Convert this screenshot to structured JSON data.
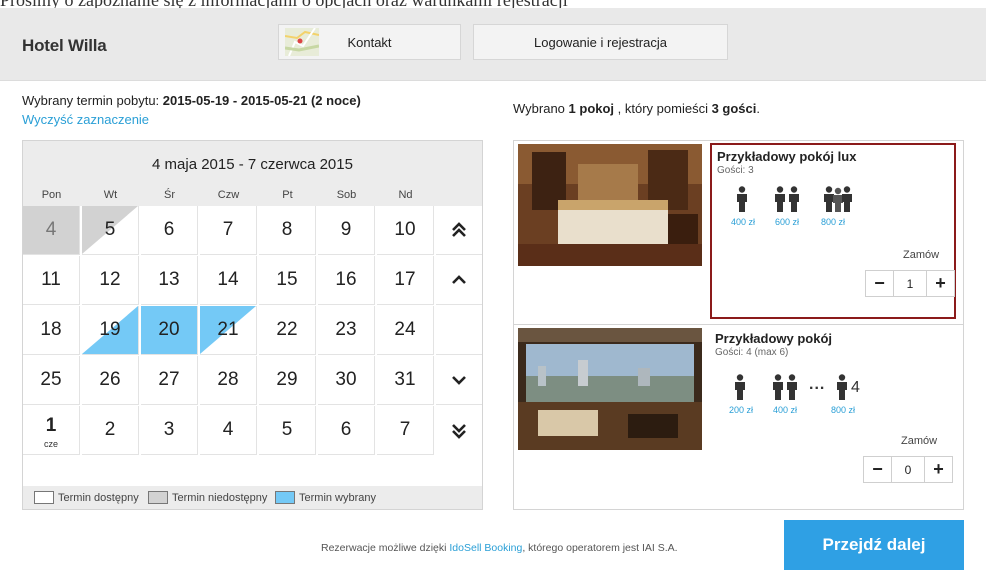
{
  "cut_text": "Prosimy o zapoznanie się z informacjami o opcjach oraz warunkami rejestracji",
  "header": {
    "brand": "Hotel Willa",
    "nav": {
      "kontakt": "Kontakt",
      "login": "Logowanie i rejestracja"
    }
  },
  "selection": {
    "prefix": "Wybrany termin pobytu: ",
    "date_from": "2015-05-19",
    "separator": " - ",
    "date_to": "2015-05-21",
    "nights": "(2 noce)",
    "clear_label": "Wyczyść zaznaczenie"
  },
  "rooms_info": {
    "prefix": "Wybrano ",
    "rooms": "1 pokoj",
    "middle": " , który pomieści ",
    "guests": "3 gości",
    "suffix": "."
  },
  "calendar": {
    "title": "4 maja 2015 - 7 czerwca 2015",
    "weekdays": [
      "Pon",
      "Wt",
      "Śr",
      "Czw",
      "Pt",
      "Sob",
      "Nd"
    ],
    "weeks": [
      [
        "4",
        "5",
        "6",
        "7",
        "8",
        "9",
        "10"
      ],
      [
        "11",
        "12",
        "13",
        "14",
        "15",
        "16",
        "17"
      ],
      [
        "18",
        "19",
        "20",
        "21",
        "22",
        "23",
        "24"
      ],
      [
        "25",
        "26",
        "27",
        "28",
        "29",
        "30",
        "31"
      ],
      [
        "1",
        "2",
        "3",
        "4",
        "5",
        "6",
        "7"
      ]
    ],
    "month_marker": "cze",
    "legend": {
      "available": "Termin dostępny",
      "unavailable": "Termin niedostępny",
      "selected": "Termin wybrany"
    },
    "colors": {
      "unavailable": "#d2d2d2",
      "selected": "#74c9f6"
    }
  },
  "rooms": [
    {
      "name": "Przykładowy pokój lux",
      "guests": "Gości: 3",
      "prices": [
        "400 zł",
        "600 zł",
        "800 zł"
      ],
      "order_label": "Zamów",
      "quantity": "1"
    },
    {
      "name": "Przykładowy pokój",
      "guests": "Gości: 4 (max 6)",
      "prices": [
        "200 zł",
        "400 zł",
        "800 zł"
      ],
      "ellipsis": "...",
      "max_count": "4",
      "order_label": "Zamów",
      "quantity": "0"
    }
  ],
  "footer": {
    "prefix": "Rezerwacje możliwe dzięki ",
    "link": "IdoSell Booking",
    "suffix": ", którego operatorem jest IAI S.A.",
    "proceed": "Przejdź dalej"
  },
  "colors": {
    "accent": "#2fa0e4",
    "link": "#2a9fd6",
    "highlight_border": "#8b1a1a"
  }
}
